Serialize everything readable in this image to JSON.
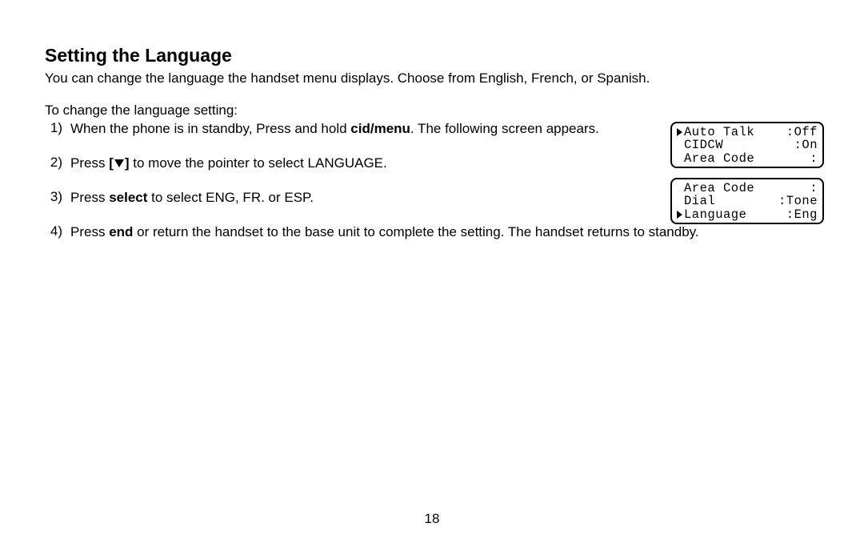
{
  "heading": "Setting the Language",
  "intro": "You can change the language the handset menu displays. Choose from English, French, or Spanish.",
  "lead": "To change the language setting:",
  "steps": {
    "s1_num": "1)",
    "s1_a": "When the phone is in standby, Press and hold ",
    "s1_b": "cid/menu",
    "s1_c": ". The following screen appears.",
    "s2_num": "2)",
    "s2_a": "Press ",
    "s2_b1": "[",
    "s2_b2": "]",
    "s2_c": " to move the pointer to select LANGUAGE.",
    "s3_num": "3)",
    "s3_a": "Press ",
    "s3_b": "select",
    "s3_c": " to select ENG, FR. or ESP.",
    "s4_num": "4)",
    "s4_a": "Press ",
    "s4_b": "end",
    "s4_c": " or return the handset to the base unit to complete the setting. The handset returns to standby."
  },
  "lcd1": {
    "l1_left": "Auto Talk",
    "l1_right": ":Off",
    "l2_left": "CIDCW",
    "l2_right": ":On",
    "l3_left": "Area Code",
    "l3_right": ":"
  },
  "lcd2": {
    "l1_left": "Area Code",
    "l1_right": ":",
    "l2_left": "Dial",
    "l2_right": ":Tone",
    "l3_left": "Language",
    "l3_right": ":Eng"
  },
  "pageNumber": "18"
}
